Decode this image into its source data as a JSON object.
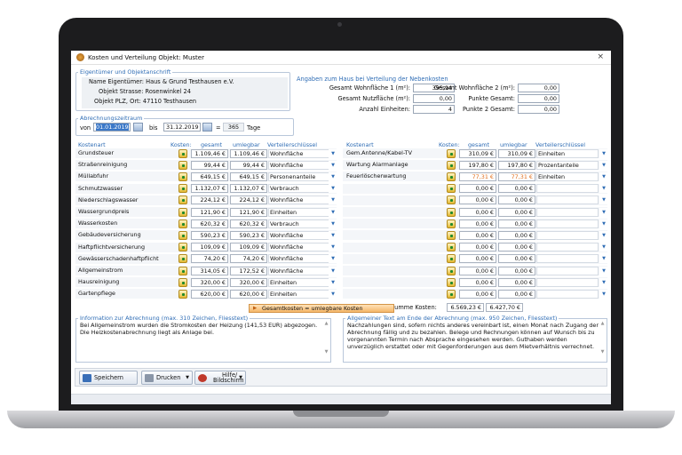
{
  "window": {
    "title": "Kosten und Verteilung Objekt: Muster",
    "close": "×"
  },
  "owner": {
    "group_title": "Eigentümer und Objektanschrift",
    "name": "Name Eigentümer: Haus & Grund Testhausen e.V.",
    "street": "Objekt Strasse: Rosenwinkel 24",
    "zip": "Objekt PLZ, Ort: 47110 Testhausen"
  },
  "period": {
    "group_title": "Abrechnungszeitraum",
    "from_label": "von",
    "from": "01.01.2019",
    "to_label": "bis",
    "to": "31.12.2019",
    "eq": "=",
    "days": "365",
    "days_label": "Tage"
  },
  "house": {
    "title": "Angaben zum Haus bei Verteilung der Nebenkosten",
    "area1_label": "Gesamt Wohnfläche 1 (m²):",
    "area1": "395,94",
    "useful_label": "Gesamt Nutzfläche (m²):",
    "useful": "0,00",
    "units_label": "Anzahl Einheiten:",
    "units": "4",
    "area2_label": "Gesamt Wohnfläche 2 (m²):",
    "area2": "0,00",
    "p1_label": "Punkte Gesamt:",
    "p1": "0,00",
    "p2_label": "Punkte 2 Gesamt:",
    "p2": "0,00"
  },
  "headers": {
    "kostenart": "Kostenart",
    "kosten": "Kosten:",
    "gesamt": "gesamt",
    "umlegbar": "umlegbar",
    "schluessel": "Verteilerschlüssel"
  },
  "left_rows": [
    {
      "name": "Grundsteuer",
      "gesamt": "1.109,46 €",
      "umlegbar": "1.109,46 €",
      "key": "Wohnfläche"
    },
    {
      "name": "Straßenreinigung",
      "gesamt": "99,44 €",
      "umlegbar": "99,44 €",
      "key": "Wohnfläche"
    },
    {
      "name": "Müllabfuhr",
      "gesamt": "649,15 €",
      "umlegbar": "649,15 €",
      "key": "Personenanteile"
    },
    {
      "name": "Schmutzwasser",
      "gesamt": "1.132,07 €",
      "umlegbar": "1.132,07 €",
      "key": "Verbrauch"
    },
    {
      "name": "Niederschlagswasser",
      "gesamt": "224,12 €",
      "umlegbar": "224,12 €",
      "key": "Wohnfläche"
    },
    {
      "name": "Wassergrundpreis",
      "gesamt": "121,90 €",
      "umlegbar": "121,90 €",
      "key": "Einheiten"
    },
    {
      "name": "Wasserkosten",
      "gesamt": "620,32 €",
      "umlegbar": "620,32 €",
      "key": "Verbrauch"
    },
    {
      "name": "Gebäudeversicherung",
      "gesamt": "590,23 €",
      "umlegbar": "590,23 €",
      "key": "Wohnfläche"
    },
    {
      "name": "Haftpflichtversicherung",
      "gesamt": "109,09 €",
      "umlegbar": "109,09 €",
      "key": "Wohnfläche"
    },
    {
      "name": "Gewässerschadenhaftpflicht",
      "gesamt": "74,20 €",
      "umlegbar": "74,20 €",
      "key": "Wohnfläche"
    },
    {
      "name": "Allgemeinstrom",
      "gesamt": "314,05 €",
      "umlegbar": "172,52 €",
      "key": "Wohnfläche"
    },
    {
      "name": "Hausreinigung",
      "gesamt": "320,00 €",
      "umlegbar": "320,00 €",
      "key": "Einheiten"
    },
    {
      "name": "Gartenpflege",
      "gesamt": "620,00 €",
      "umlegbar": "620,00 €",
      "key": "Einheiten"
    }
  ],
  "right_rows": [
    {
      "name": "Gem.Antenne/Kabel-TV",
      "gesamt": "310,09 €",
      "umlegbar": "310,09 €",
      "key": "Einheiten",
      "red": false
    },
    {
      "name": "Wartung Alarmanlage",
      "gesamt": "197,80 €",
      "umlegbar": "197,80 €",
      "key": "Prozentanteile",
      "red": false
    },
    {
      "name": "Feuerlöscherwartung",
      "gesamt": "77,31 €",
      "umlegbar": "77,31 €",
      "key": "Einheiten",
      "red": true
    },
    {
      "name": "",
      "gesamt": "0,00 €",
      "umlegbar": "0,00 €",
      "key": "",
      "red": false
    },
    {
      "name": "",
      "gesamt": "0,00 €",
      "umlegbar": "0,00 €",
      "key": "",
      "red": false
    },
    {
      "name": "",
      "gesamt": "0,00 €",
      "umlegbar": "0,00 €",
      "key": "",
      "red": false
    },
    {
      "name": "",
      "gesamt": "0,00 €",
      "umlegbar": "0,00 €",
      "key": "",
      "red": false
    },
    {
      "name": "",
      "gesamt": "0,00 €",
      "umlegbar": "0,00 €",
      "key": "",
      "red": false
    },
    {
      "name": "",
      "gesamt": "0,00 €",
      "umlegbar": "0,00 €",
      "key": "",
      "red": false
    },
    {
      "name": "",
      "gesamt": "0,00 €",
      "umlegbar": "0,00 €",
      "key": "",
      "red": false
    },
    {
      "name": "",
      "gesamt": "0,00 €",
      "umlegbar": "0,00 €",
      "key": "",
      "red": false
    },
    {
      "name": "",
      "gesamt": "0,00 €",
      "umlegbar": "0,00 €",
      "key": "",
      "red": false
    },
    {
      "name": "",
      "gesamt": "0,00 €",
      "umlegbar": "0,00 €",
      "key": "",
      "red": false
    }
  ],
  "sum": {
    "label": "Summe Kosten:",
    "gesamt": "6.569,23 €",
    "umlegbar": "6.427,70 €"
  },
  "sum_button": "Gesamtkosten = umlegbare Kosten",
  "info": {
    "title": "Information zur Abrechnung (max. 310 Zeichen, Fliesstext)",
    "text": "Bei Allgemeinstrom wurden die Stromkosten der Heizung (141,53 EUR) abgezogen. Die Heizkostenabrechnung liegt als Anlage bei."
  },
  "general": {
    "title": "Allgemeiner Text am Ende der Abrechnung (max. 950 Zeichen, Fliesstext)",
    "text": "Nachzahlungen sind, sofern nichts anderes vereinbart ist, einen Monat nach Zugang der Abrechnung fällig und zu bezahlen. Belege und Rechnungen können auf Wunsch bis zu vorgenannten Termin nach Absprache eingesehen werden. Guthaben werden unverzüglich erstattet oder mit Gegenforderungen aus dem Mietverhältnis verrechnet."
  },
  "toolbar": {
    "save": "Speichern",
    "print": "Drucken",
    "help_1": "Hilfe/",
    "help_2": "Bildschirm"
  },
  "colors": {
    "accent": "#2f6db5",
    "orange": "#e0701f"
  }
}
